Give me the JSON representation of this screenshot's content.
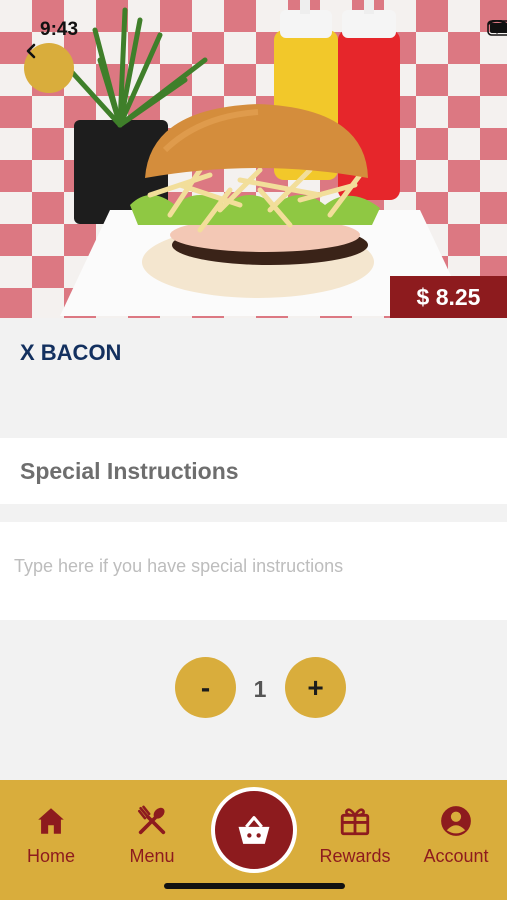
{
  "status_bar": {
    "time": "9:43"
  },
  "product": {
    "name": "X BACON",
    "price": "$ 8.25"
  },
  "special_instructions": {
    "title": "Special Instructions",
    "placeholder": "Type here if you have special instructions",
    "value": ""
  },
  "quantity": {
    "minus_label": "-",
    "value": "1",
    "plus_label": "+"
  },
  "bottom_nav": {
    "items": [
      {
        "label": "Home",
        "icon": "home-icon"
      },
      {
        "label": "Menu",
        "icon": "fork-knife-icon"
      },
      {
        "label": "Rewards",
        "icon": "gift-icon"
      },
      {
        "label": "Account",
        "icon": "account-icon"
      }
    ],
    "center_icon": "basket-icon"
  },
  "colors": {
    "accent_gold": "#d9ad3c",
    "brand_red": "#8d1b1e",
    "title_navy": "#13305f"
  }
}
